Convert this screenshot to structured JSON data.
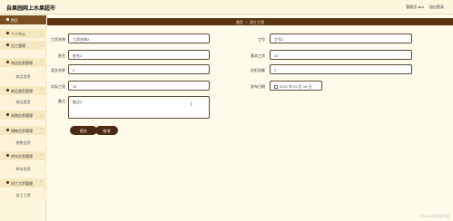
{
  "header": {
    "title": "自果园网上水果超市",
    "links": [
      "管理员 abo",
      "退出登录"
    ]
  },
  "sidebar": {
    "items": [
      {
        "label": "首页",
        "type": "home"
      },
      {
        "label": "个人中心",
        "type": "group"
      },
      {
        "label": "员工管理",
        "type": "group"
      },
      {
        "label": "商品信息管理",
        "type": "group"
      },
      {
        "label": "商品信息",
        "type": "sub"
      },
      {
        "label": "商品类型管理",
        "type": "group"
      },
      {
        "label": "商品类型",
        "type": "sub"
      },
      {
        "label": "采购信息管理",
        "type": "group"
      },
      {
        "label": "销售信息管理",
        "type": "group"
      },
      {
        "label": "销售信息",
        "type": "sub"
      },
      {
        "label": "库存信息管理",
        "type": "group"
      },
      {
        "label": "库存信息",
        "type": "sub"
      },
      {
        "label": "员工工资管理",
        "type": "group"
      },
      {
        "label": "员工工资",
        "type": "sub"
      }
    ]
  },
  "breadcrumb": {
    "home": "首页",
    "separator": "/",
    "current": "员工工资"
  },
  "form": {
    "left": [
      {
        "label": "工资名称",
        "value": "工资名称2"
      },
      {
        "label": "姓名",
        "value": "姓名2"
      },
      {
        "label": "奖金名称",
        "value": "2"
      },
      {
        "label": "实际工资",
        "value": "10"
      }
    ],
    "right": [
      {
        "label": "工号",
        "value": "工号2"
      },
      {
        "label": "基本工资",
        "value": "10"
      },
      {
        "label": "应扣金额",
        "value": "2"
      },
      {
        "label": "发布日期",
        "value": "2022 年 03 月 09 日"
      }
    ],
    "remark_label": "备注",
    "remark_value": "备注2"
  },
  "buttons": {
    "submit": "提交",
    "cancel": "取消"
  },
  "watermark": "CSDN @后端毕设",
  "colors": {
    "accent": "#5c3510",
    "button": "#4a2a12",
    "background": "#fffbea",
    "sidebar": "#fdf6dd"
  }
}
